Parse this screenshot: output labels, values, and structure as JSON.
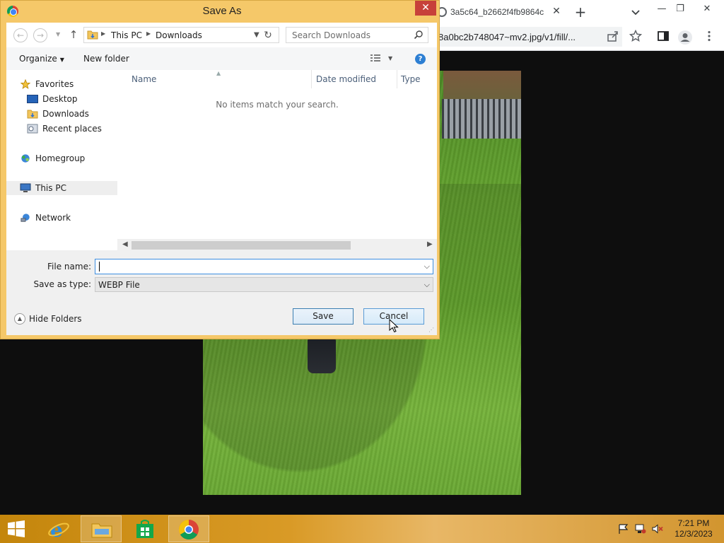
{
  "browser": {
    "tab_title": "3a5c64_b2662f4fb9864c",
    "address_url": "8a0bc2b748047~mv2.jpg/v1/fill/...",
    "colors": {
      "window_bg": "#0e0e0e",
      "toolbar_bg": "#ffffff"
    }
  },
  "dialog": {
    "title": "Save As",
    "close_label": "✕",
    "nav": {
      "breadcrumb": [
        "This PC",
        "Downloads"
      ],
      "search_placeholder": "Search Downloads"
    },
    "commands": {
      "organize": "Organize",
      "new_folder": "New folder"
    },
    "nav_pane": {
      "favorites": "Favorites",
      "desktop": "Desktop",
      "downloads": "Downloads",
      "recent": "Recent places",
      "homegroup": "Homegroup",
      "this_pc": "This PC",
      "network": "Network"
    },
    "file_list": {
      "columns": [
        "Name",
        "Date modified",
        "Type"
      ],
      "empty_message": "No items match your search."
    },
    "form": {
      "file_name_label": "File name:",
      "file_name_value": "",
      "save_type_label": "Save as type:",
      "save_type_value": "WEBP File",
      "hide_folders": "Hide Folders",
      "save": "Save",
      "cancel": "Cancel"
    },
    "colors": {
      "frame": "#f5c869",
      "close_bg": "#c7413a",
      "focus": "#3d8ee0"
    }
  },
  "taskbar": {
    "time": "7:21 PM",
    "date": "12/3/2023",
    "apps": [
      "internet-explorer",
      "file-explorer",
      "store",
      "chrome"
    ]
  }
}
